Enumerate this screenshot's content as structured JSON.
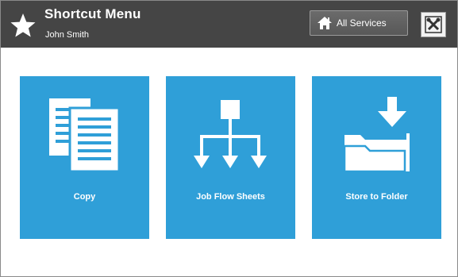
{
  "header": {
    "title": "Shortcut Menu",
    "user": "John Smith",
    "all_services_label": "All Services"
  },
  "icons": {
    "header": "star-icon",
    "all_services": "home-icon",
    "tools": "tools-icon"
  },
  "tiles": [
    {
      "label": "Copy",
      "icon": "copy-icon"
    },
    {
      "label": "Job Flow Sheets",
      "icon": "job-flow-icon"
    },
    {
      "label": "Store to Folder",
      "icon": "store-folder-icon"
    }
  ],
  "colors": {
    "header_bg": "#454545",
    "tile_bg": "#2f9fd8",
    "text_light": "#ffffff"
  }
}
